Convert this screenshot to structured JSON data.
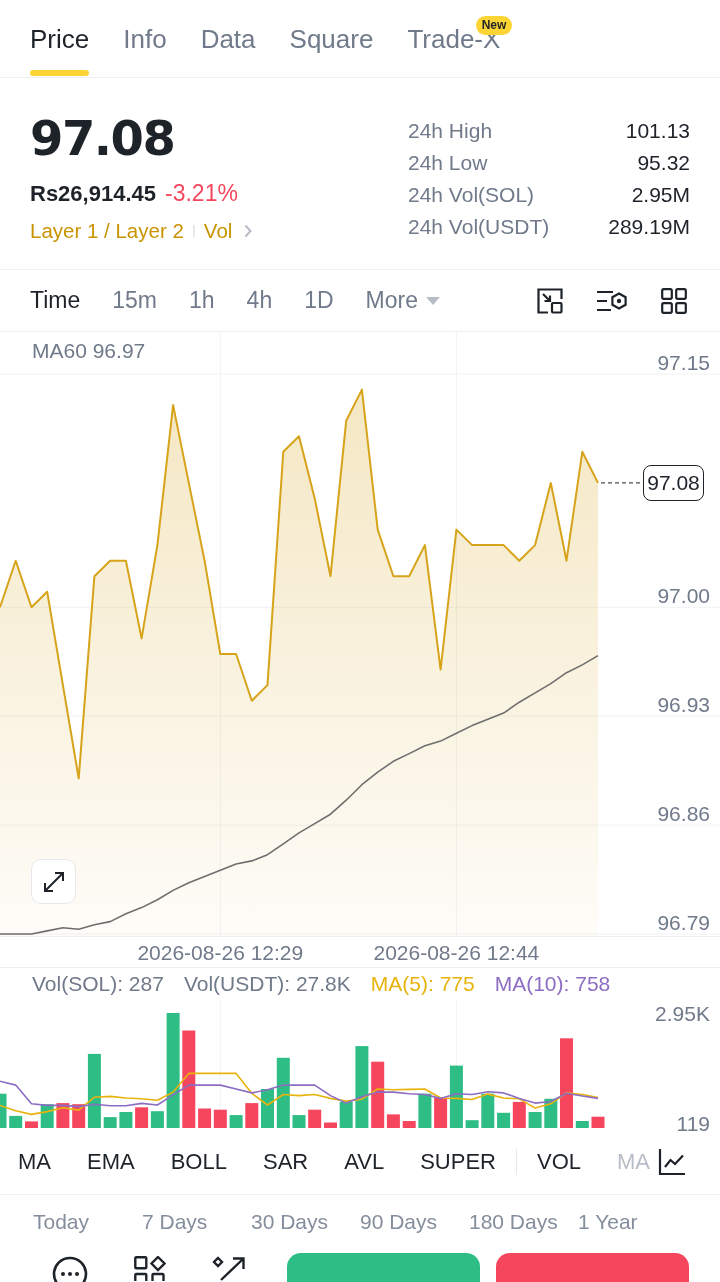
{
  "tabs": [
    {
      "label": "Price",
      "selected": true
    },
    {
      "label": "Info",
      "selected": false
    },
    {
      "label": "Data",
      "selected": false
    },
    {
      "label": "Square",
      "selected": false
    },
    {
      "label": "Trade-X",
      "selected": false,
      "badge": "New"
    }
  ],
  "ticker": {
    "last_price": "97.08",
    "fiat_price": "Rs26,914.45",
    "change": "-3.21%",
    "negative": true,
    "tags": [
      "Layer 1 / Layer 2",
      "Vol"
    ]
  },
  "stats": [
    {
      "label": "24h High",
      "value": "101.13"
    },
    {
      "label": "24h Low",
      "value": "95.32"
    },
    {
      "label": "24h Vol(SOL)",
      "value": "2.95M"
    },
    {
      "label": "24h Vol(USDT)",
      "value": "289.19M"
    }
  ],
  "intervals": [
    {
      "label": "Time",
      "selected": true,
      "dropdown": false
    },
    {
      "label": "15m",
      "selected": false,
      "dropdown": false
    },
    {
      "label": "1h",
      "selected": false,
      "dropdown": false
    },
    {
      "label": "4h",
      "selected": false,
      "dropdown": false
    },
    {
      "label": "1D",
      "selected": false,
      "dropdown": false
    },
    {
      "label": "More",
      "selected": false,
      "dropdown": true
    }
  ],
  "price_chart": {
    "ma_label": "MA60 96.97",
    "last_price_tag": "97.08",
    "chart_data": {
      "type": "area",
      "grid": true,
      "ylim": [
        96.79,
        97.15
      ],
      "yticks": [
        97.15,
        {
          "value": 97,
          "label": "97.00"
        },
        96.93,
        96.86,
        96.79
      ],
      "categories": [
        null,
        null,
        null,
        null,
        null,
        null,
        null,
        null,
        null,
        null,
        null,
        null,
        null,
        null,
        "2026-08-26 12:29",
        null,
        null,
        null,
        null,
        null,
        null,
        null,
        null,
        null,
        null,
        null,
        null,
        null,
        null,
        "2026-08-26 12:44",
        null,
        null,
        null,
        null,
        null,
        null,
        null,
        null,
        null
      ],
      "series": [
        {
          "color": "#d6a31a",
          "values": [
            97.0,
            97.03,
            97.0,
            97.01,
            96.95,
            96.89,
            97.02,
            97.03,
            97.03,
            96.98,
            97.04,
            97.13,
            97.08,
            97.03,
            96.97,
            96.97,
            96.94,
            96.95,
            97.1,
            97.11,
            97.07,
            97.02,
            97.12,
            97.14,
            97.05,
            97.02,
            97.02,
            97.04,
            96.96,
            97.05,
            97.04,
            97.04,
            97.04,
            97.03,
            97.04,
            97.08,
            97.03,
            97.1,
            97.08
          ]
        },
        {
          "type": "line",
          "color": "#6e6e6e",
          "values": [
            96.79,
            96.79,
            96.79,
            96.792,
            96.794,
            96.793,
            96.796,
            96.798,
            96.803,
            96.807,
            96.812,
            96.818,
            96.823,
            96.827,
            96.831,
            96.835,
            96.837,
            96.841,
            96.848,
            96.855,
            96.861,
            96.867,
            96.876,
            96.886,
            96.894,
            96.901,
            96.906,
            96.911,
            96.914,
            96.919,
            96.924,
            96.928,
            96.932,
            96.939,
            96.945,
            96.951,
            96.958,
            96.963,
            96.969
          ]
        }
      ]
    }
  },
  "volume_chart": {
    "legend": [
      {
        "text": "Vol(SOL): 287",
        "color": "#707a8a"
      },
      {
        "text": "Vol(USDT): 27.8K",
        "color": "#707a8a"
      },
      {
        "text": "MA(5): 775",
        "color": "#e8b30d"
      },
      {
        "text": "MA(10): 758",
        "color": "#8c6dc3"
      }
    ],
    "chart_data": {
      "type": "bar",
      "grid": true,
      "ylim": [
        0,
        2950
      ],
      "yticks": [
        {
          "value": 2950,
          "label": "2.95K"
        },
        {
          "value": 119,
          "label": "119"
        }
      ],
      "categories": [
        null,
        null,
        null,
        null,
        null,
        null,
        null,
        null,
        null,
        null,
        null,
        null,
        null,
        null,
        null,
        null,
        null,
        null,
        null,
        null,
        null,
        null,
        null,
        null,
        null,
        null,
        null,
        null,
        null,
        null,
        null,
        null,
        null,
        null,
        null,
        null,
        null,
        null,
        null
      ],
      "series": [
        {
          "colors": [
            "#2ebd85",
            "#2ebd85",
            "#f6465d",
            "#2ebd85",
            "#f6465d",
            "#f6465d",
            "#2ebd85",
            "#2ebd85",
            "#2ebd85",
            "#f6465d",
            "#2ebd85",
            "#2ebd85",
            "#f6465d",
            "#f6465d",
            "#f6465d",
            "#2ebd85",
            "#f6465d",
            "#2ebd85",
            "#2ebd85",
            "#2ebd85",
            "#f6465d",
            "#f6465d",
            "#2ebd85",
            "#2ebd85",
            "#f6465d",
            "#f6465d",
            "#f6465d",
            "#2ebd85",
            "#f6465d",
            "#2ebd85",
            "#2ebd85",
            "#2ebd85",
            "#2ebd85",
            "#f6465d",
            "#2ebd85",
            "#2ebd85",
            "#f6465d",
            "#2ebd85",
            "#f6465d"
          ],
          "values": [
            880,
            310,
            170,
            610,
            640,
            610,
            1900,
            280,
            410,
            530,
            430,
            2950,
            2500,
            500,
            470,
            330,
            640,
            1000,
            1800,
            330,
            470,
            140,
            670,
            2100,
            1700,
            350,
            180,
            880,
            780,
            1600,
            200,
            880,
            390,
            670,
            410,
            750,
            2300,
            180,
            290
          ]
        },
        {
          "type": "line",
          "color": "#e8b30d",
          "values": [
            580,
            440,
            350,
            420,
            520,
            460,
            790,
            810,
            770,
            750,
            710,
            920,
            1400,
            1400,
            1400,
            1400,
            890,
            590,
            860,
            830,
            860,
            760,
            690,
            740,
            1000,
            980,
            990,
            1000,
            770,
            760,
            730,
            870,
            770,
            750,
            510,
            620,
            900,
            860,
            780
          ]
        },
        {
          "type": "line",
          "color": "#8c6dc3",
          "values": [
            1200,
            1100,
            620,
            580,
            580,
            550,
            610,
            570,
            570,
            630,
            590,
            850,
            1100,
            1100,
            1100,
            1000,
            900,
            980,
            1100,
            1100,
            1100,
            830,
            640,
            800,
            920,
            920,
            880,
            860,
            760,
            880,
            860,
            930,
            900,
            760,
            640,
            680,
            890,
            820,
            760
          ]
        }
      ]
    }
  },
  "indicators": {
    "main": [
      "MA",
      "EMA",
      "BOLL",
      "SAR",
      "AVL",
      "SUPER"
    ],
    "sub": [
      "VOL",
      "MA"
    ]
  },
  "periods": [
    "Today",
    "7 Days",
    "30 Days",
    "90 Days",
    "180 Days",
    "1 Year"
  ],
  "action_buttons": [
    {
      "kind": "buy"
    },
    {
      "kind": "sell"
    }
  ]
}
